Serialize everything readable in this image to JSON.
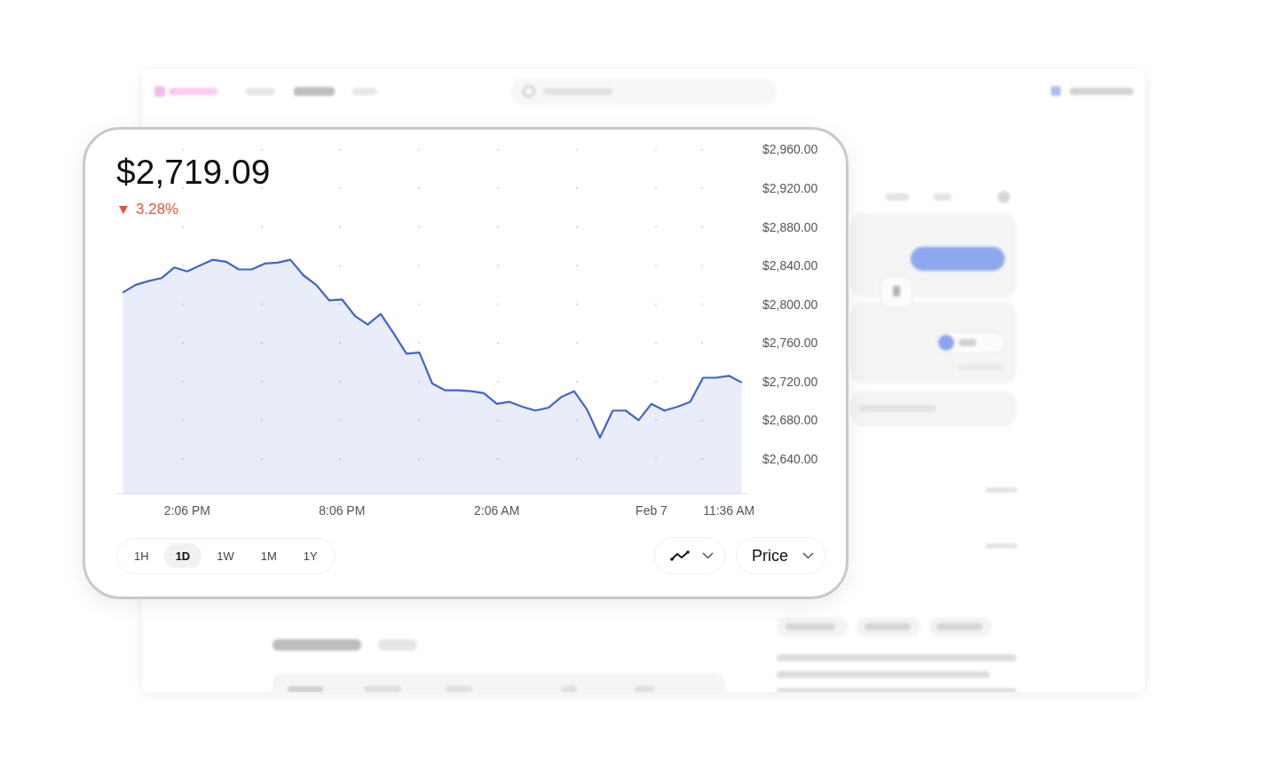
{
  "price_card": {
    "price": "$2,719.09",
    "change": {
      "text": "3.28%"
    },
    "chart_data": {
      "type": "area",
      "categories": [
        null,
        null,
        null,
        null,
        null,
        "2:06 PM",
        null,
        null,
        null,
        null,
        null,
        null,
        null,
        null,
        null,
        null,
        null,
        "8:06 PM",
        null,
        null,
        null,
        null,
        null,
        null,
        null,
        null,
        null,
        null,
        null,
        "2:06 AM",
        null,
        null,
        null,
        null,
        null,
        null,
        null,
        null,
        null,
        null,
        null,
        "Feb 7",
        null,
        null,
        null,
        null,
        null,
        "11:36 AM",
        null
      ],
      "ylim": [
        2604,
        2960
      ],
      "series": [
        {
          "color": "#3f64cc",
          "values": [
            2812,
            2820,
            2824,
            2827,
            2838,
            2834,
            2840,
            2846,
            2844,
            2836,
            2836,
            2842,
            2843,
            2846,
            2830,
            2820,
            2804,
            2805,
            2788,
            2779,
            2790,
            2770,
            2749,
            2750,
            2718,
            2711,
            2711,
            2710,
            2708,
            2697,
            2699,
            2694,
            2690,
            2693,
            2704,
            2710,
            2691,
            2662,
            2690,
            2690,
            2680,
            2697,
            2690,
            2694,
            2699,
            2724,
            2724,
            2726,
            2719
          ]
        }
      ],
      "yticks": [
        {
          "value": 2960,
          "label": "$2,960.00"
        },
        {
          "value": 2920,
          "label": "$2,920.00"
        },
        {
          "value": 2880,
          "label": "$2,880.00"
        },
        {
          "value": 2840,
          "label": "$2,840.00"
        },
        {
          "value": 2800,
          "label": "$2,800.00"
        },
        {
          "value": 2760,
          "label": "$2,760.00"
        },
        {
          "value": 2720,
          "label": "$2,720.00"
        },
        {
          "value": 2680,
          "label": "$2,680.00"
        },
        {
          "value": 2640,
          "label": "$2,640.00"
        }
      ]
    },
    "timeframes": [
      {
        "label": "1H",
        "selected": false
      },
      {
        "label": "1D",
        "selected": true
      },
      {
        "label": "1W",
        "selected": false
      },
      {
        "label": "1M",
        "selected": false
      },
      {
        "label": "1Y",
        "selected": false
      }
    ],
    "metric_menu": {
      "label": "Price"
    }
  }
}
